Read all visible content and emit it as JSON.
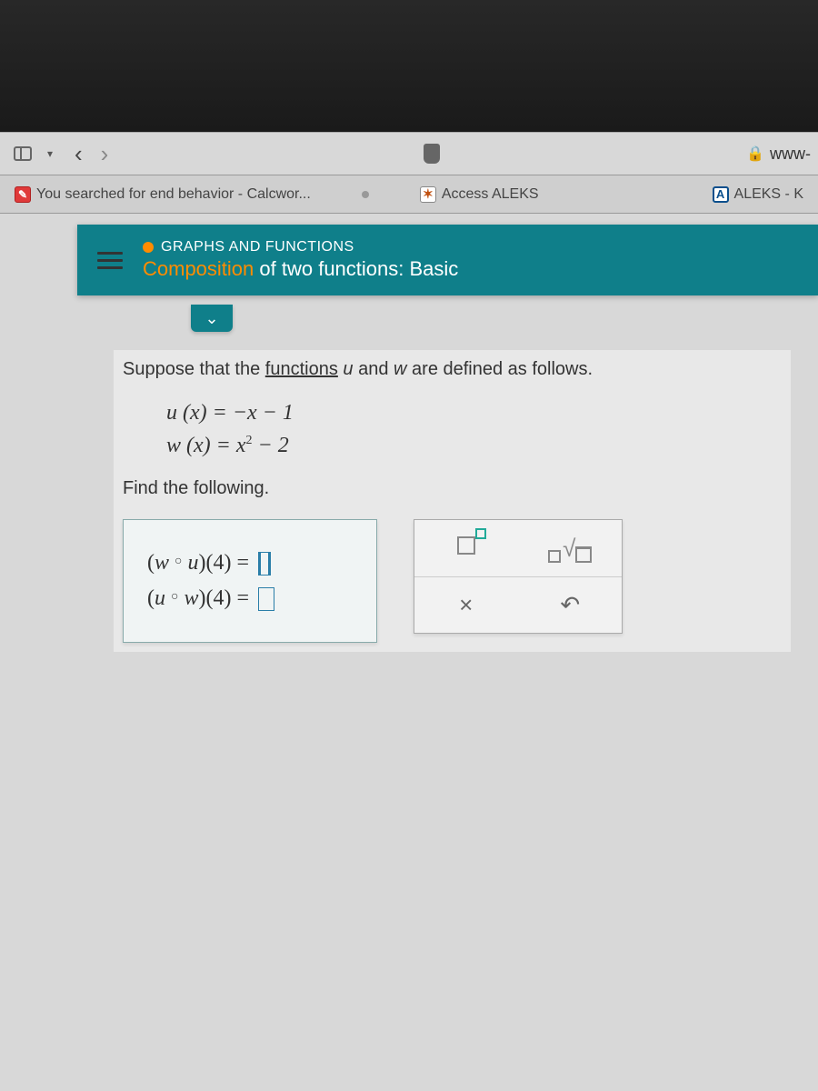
{
  "browser": {
    "url_text": "www-"
  },
  "tabs": {
    "t1": "You searched for end behavior - Calcwor...",
    "t2": "Access ALEKS",
    "t3": "ALEKS - K"
  },
  "header": {
    "category": "GRAPHS AND FUNCTIONS",
    "title_a": "Composition",
    "title_b": " of two functions: Basic"
  },
  "problem": {
    "intro_a": "Suppose that the ",
    "intro_link": "functions",
    "intro_b": " and ",
    "intro_c": " are defined as follows.",
    "eq1": "u (x) = −x − 1",
    "eq2_a": "w (x) = x",
    "eq2_b": " − 2",
    "find": "Find the following.",
    "ans1_a": "(w ",
    "ans1_b": " u)(4) = ",
    "ans2_a": "(u ",
    "ans2_b": " w)(4) = "
  },
  "tools": {
    "times": "×",
    "undo": "↶"
  }
}
